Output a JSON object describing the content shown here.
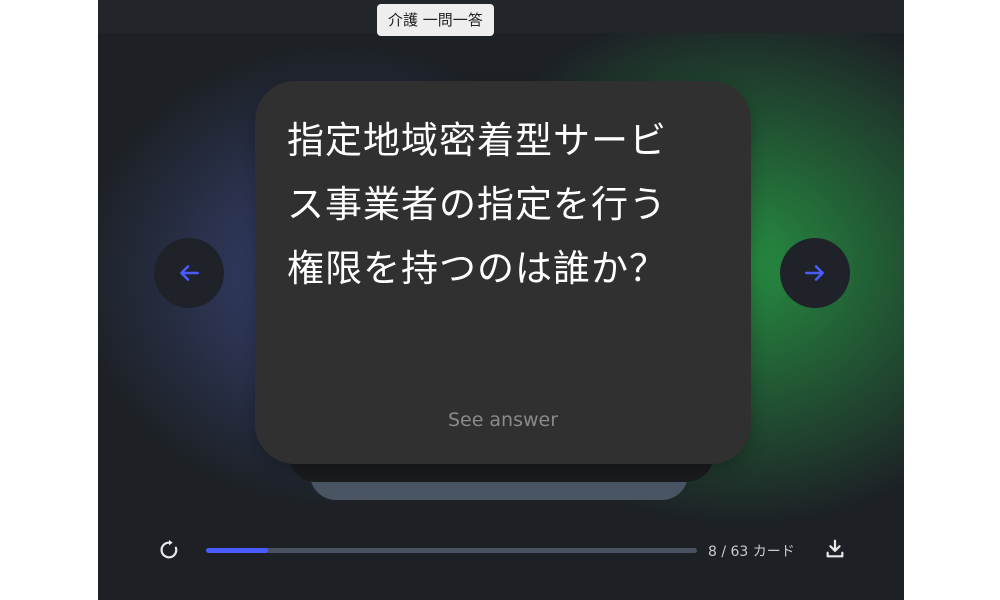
{
  "header": {
    "title": "介護 一問一答"
  },
  "card": {
    "question": "指定地域密着型サービス事業者の指定を行う権限を持つのは誰か？",
    "answer_button": "See answer"
  },
  "navigation": {
    "prev_icon": "arrow-left-icon",
    "next_icon": "arrow-right-icon",
    "accent_color": "#4a5bff"
  },
  "footer": {
    "reset_icon": "refresh-icon",
    "progress_fraction": 0.127,
    "counter": "8 / 63 カード",
    "download_icon": "download-icon"
  }
}
